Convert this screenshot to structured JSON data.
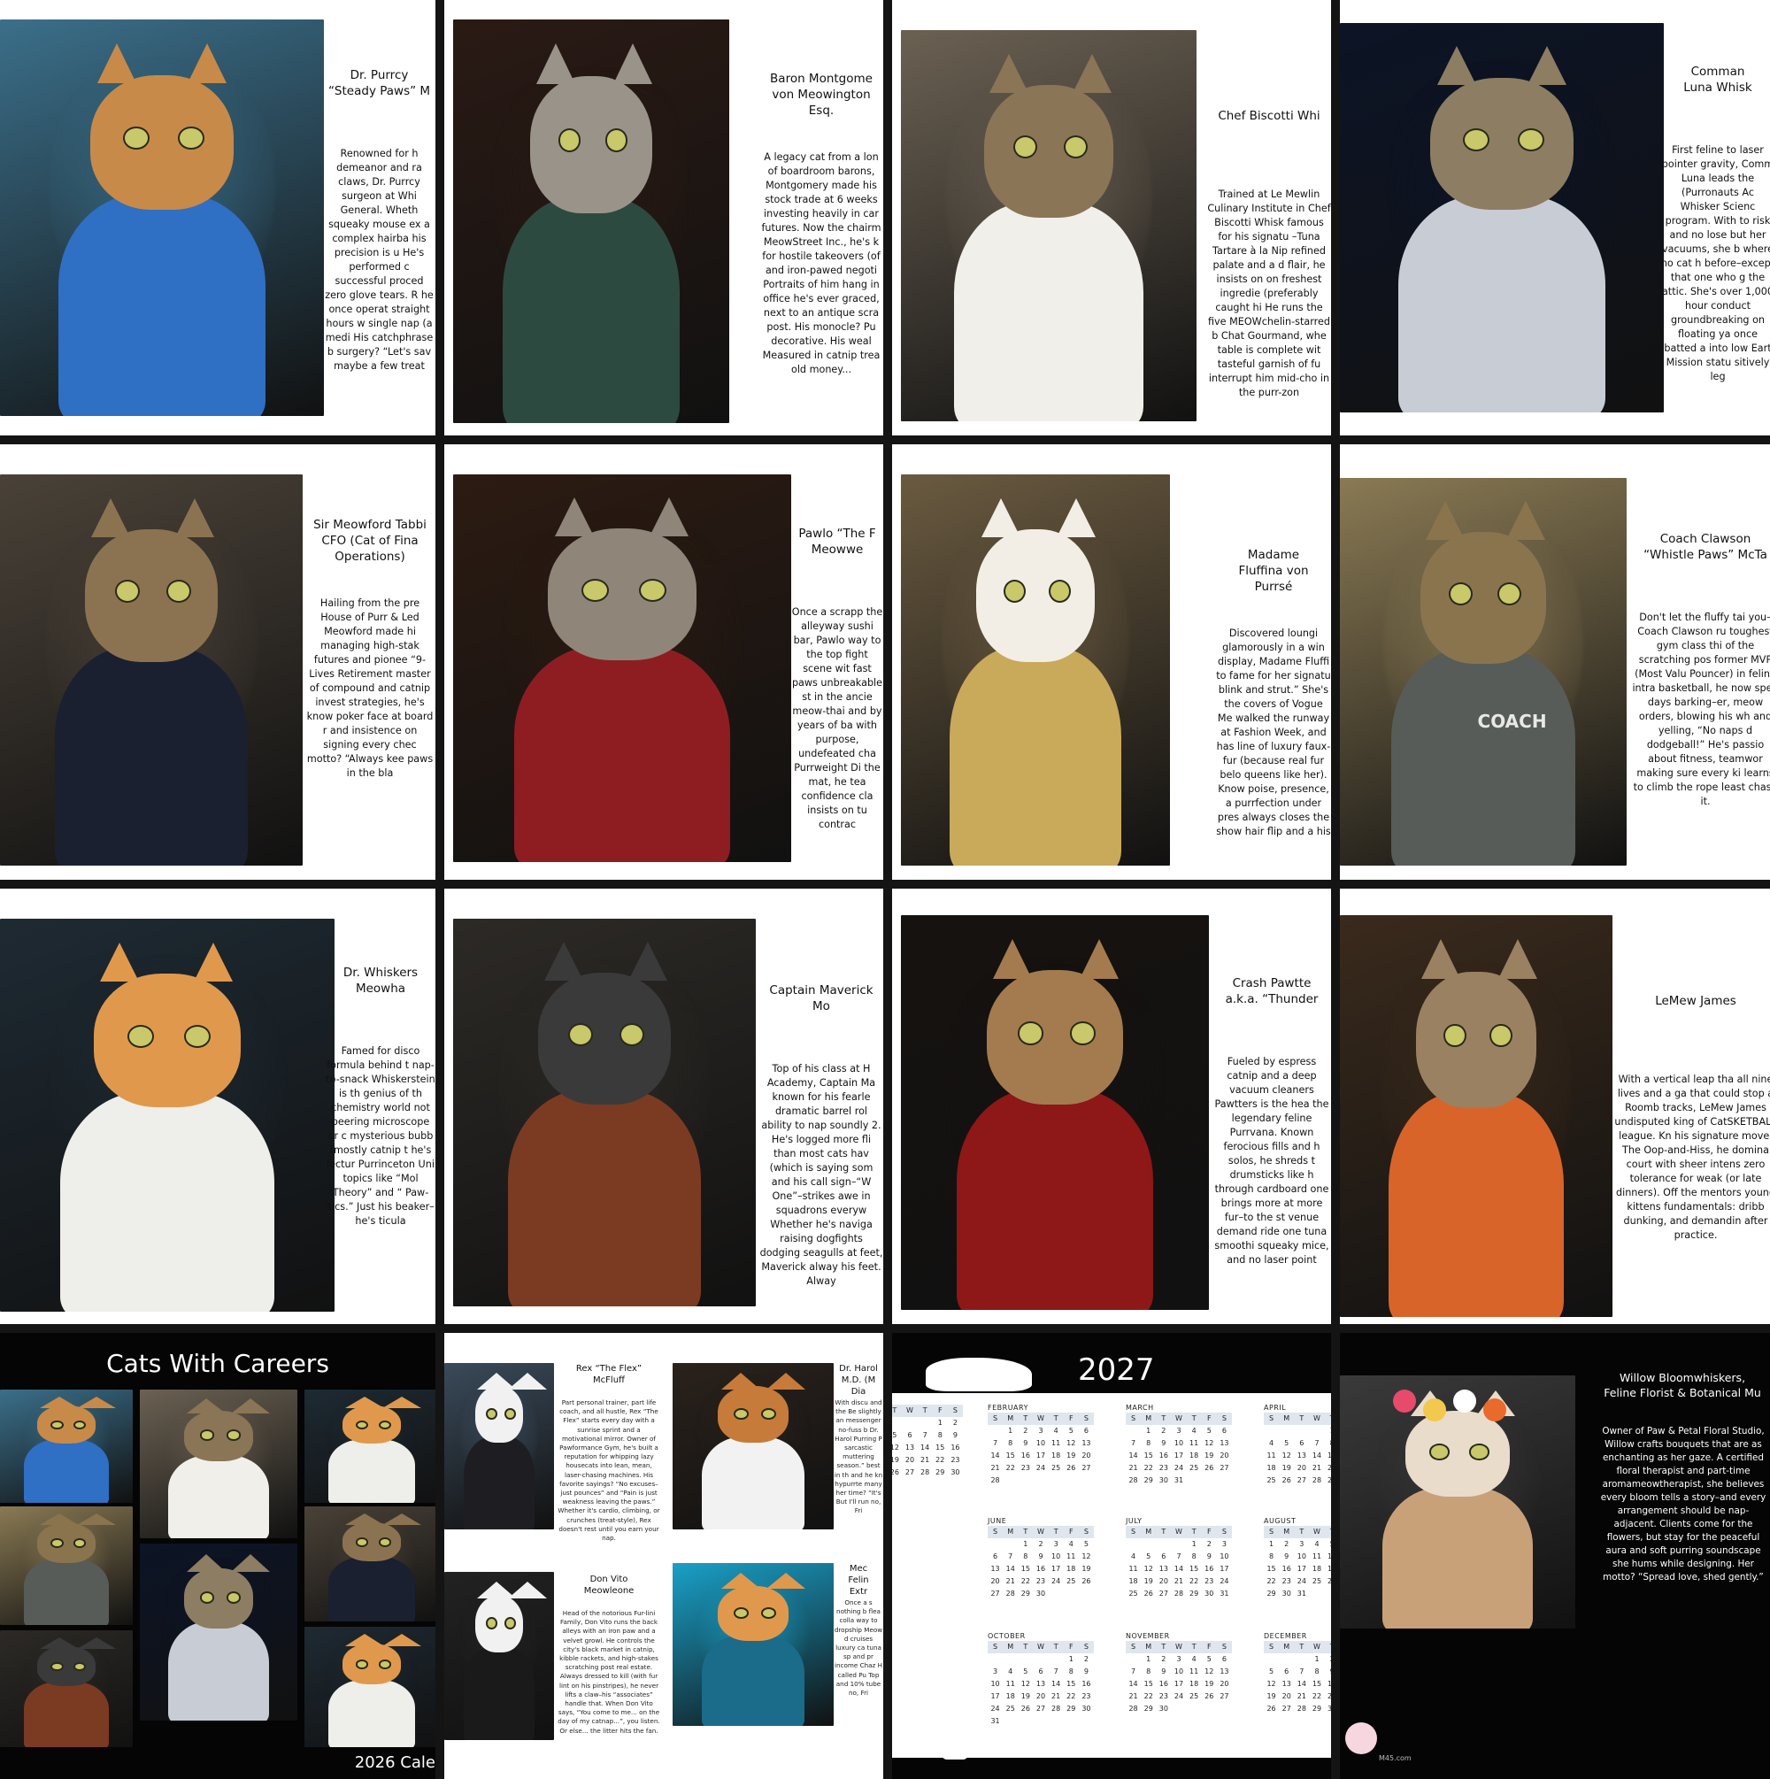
{
  "panels": [
    {
      "title": "Dr. Purrcy\n“Steady Paws” M",
      "body": "Renowned for h demeanor and ra claws, Dr. Purrcy surgeon at Whi General. Wheth squeaky mouse ex a complex hairba his precision is u He's performed c successful proced zero glove tears. R he once operat straight hours w single nap (a medi His catchphrase b surgery? “Let's sav maybe a few treat",
      "colors": {
        "bg": "#3b6f8a",
        "fur": "#c88a48",
        "body": "#2f6fc4"
      }
    },
    {
      "title": "Baron Montgome\nvon Meowington\nEsq.",
      "body": "A legacy cat from a lon of boardroom barons, Montgomery made his stock trade at 6 weeks investing heavily in car futures. Now the chairm MeowStreet Inc., he's k for hostile takeovers (of and iron-pawed negoti Portraits of him hang in office he's ever graced, next to an antique scra post. His monocle? Pu decorative. His weal Measured in catnip trea old money...",
      "colors": {
        "bg": "#2a1a14",
        "fur": "#9a938a",
        "body": "#2d4a40"
      }
    },
    {
      "title": "Chef Biscotti Whi",
      "body": "Trained at Le Mewlin Culinary Institute in Chef Biscotti Whisk famous for his signatu –Tuna Tartare à la Nip refined palate and a d flair, he insists on on freshest ingredie (preferably caught hi He runs the five MEOWchelin-starred b Chat Gourmand, whe table is complete wit tasteful garnish of fu interrupt him mid-cho in the purr-zon",
      "colors": {
        "bg": "#6b6153",
        "fur": "#8a7556",
        "body": "#f1efe9"
      }
    },
    {
      "title": "Comman\nLuna Whisk",
      "body": "First feline to laser pointer gravity, Comm Luna leads the (Purronauts Ac Whisker Scienc program. With to risk and no lose but her vacuums, she b where no cat h before–except that one who g the attic. She's over 1,000 hour conduct groundbreaking on floating ya once batted a into low Eart Mission statu sitively leg",
      "colors": {
        "bg": "#0c1426",
        "fur": "#8d7d62",
        "body": "#c8ccd4"
      }
    },
    {
      "title": "Sir Meowford Tabbi\nCFO (Cat of Fina\nOperations)",
      "body": "Hailing from the pre House of Purr & Led Meowford made hi managing high-stak futures and pionee “9-Lives Retirement master of compound and catnip invest strategies, he's know poker face at board r and insistence on signing every chec motto? “Always kee paws in the bla",
      "colors": {
        "bg": "#4a4238",
        "fur": "#8b7351",
        "body": "#1a2030"
      }
    },
    {
      "title": "Pawlo “The F\nMeowwe",
      "body": "Once a scrapp the alleyway sushi bar, Pawlo way to the top fight scene wit fast paws unbreakable st in the ancie meow-thai and by years of ba with purpose, undefeated cha Purrweight Di the mat, he tea confidence cla insists on tu contrac",
      "colors": {
        "bg": "#2c1b12",
        "fur": "#8f8679",
        "body": "#8e1d22"
      }
    },
    {
      "title": "Madame\nFluffina von\nPurrsé",
      "body": "Discovered loungi glamorously in a win display, Madame Fluffi to fame for her signatu blink and strut.” She's the covers of Vogue Me walked the runway at Fashion Week, and has line of luxury faux-fur (because real fur belo queens like her). Know poise, presence, a purrfection under pres always closes the show hair flip and a his",
      "colors": {
        "bg": "#6a5a40",
        "fur": "#f2eee6",
        "body": "#c9a95a"
      }
    },
    {
      "title": "Coach Clawson\n“Whistle Paws” McTa",
      "body": "Don't let the fluffy tai you–Coach Clawson ru toughest gym class thi of the scratching pos former MVP (Most Valu Pouncer) in feline intra basketball, he now spen days barking–er, meow orders, blowing his wh and yelling, “No naps d dodgeball!” He's passio about fitness, teamwor making sure every ki learns to climb the rope least chase it.",
      "badge": "COACH",
      "colors": {
        "bg": "#8a7a54",
        "fur": "#8a744e",
        "body": "#575c58"
      }
    },
    {
      "title": "Dr. Whiskers\nMeowha",
      "body": "Famed for disco formula behind t nap-to-snack Whiskerstein is th genius of th chemistry world not peering microscope or c mysterious bubb (mostly catnip t he's lectur Purrinceton Uni topics like “Mol Theory” and “ Paw-sics.” Just his beaker–he's ticula",
      "colors": {
        "bg": "#1e2a33",
        "fur": "#e0994c",
        "body": "#eeeeea"
      }
    },
    {
      "title": "Captain Maverick Mo",
      "body": "Top of his class at H Academy, Captain Ma known for his fearle dramatic barrel rol ability to nap soundly 2. He's logged more fli than most cats hav (which is saying som and his call sign–“W One”–strikes awe in squadrons everyw Whether he's naviga raising dogfights dodging seagulls at feet, Maverick alway his feet. Alway",
      "colors": {
        "bg": "#2d2a26",
        "fur": "#3a3a3a",
        "body": "#7b3b22"
      }
    },
    {
      "title": "Crash Pawtte\na.k.a. “Thunder",
      "body": "Fueled by espress catnip and a deep vacuum cleaners Pawtters is the hea the legendary feline Purrvana. Known ferocious fills and h solos, he shreds t drumsticks like h through cardboard one brings more at more fur–to the st venue demand ride one tuna smoothi squeaky mice, and no laser point",
      "colors": {
        "bg": "#161210",
        "fur": "#a37b4e",
        "body": "#8e1717"
      }
    },
    {
      "title": "LeMew James",
      "body": "With a vertical leap tha all nine lives and a ga that could stop a Roomb tracks, LeMew James undisputed king of CatSKETBALL league. Kn his signature move, The Oop-and-Hiss, he domina court with sheer intens zero tolerance for weak (or late dinners). Off the mentors young kittens fundamentals: dribb dunking, and demandin after practice.",
      "colors": {
        "bg": "#3a2a1c",
        "fur": "#9a8161",
        "body": "#d8642a"
      }
    }
  ],
  "cover": {
    "title": "Cats With Careers",
    "footer": "2026 Cale",
    "thumb_labels": [
      "COACH"
    ]
  },
  "spread": {
    "items": [
      {
        "title": "Rex “The Flex”\nMcFluff",
        "body": "Part personal trainer, part life coach, and all hustle, Rex “The Flex” starts every day with a sunrise sprint and a motivational mirror. Owner of Pawformance Gym, he's built a reputation for whipping lazy housecats into lean, mean, laser-chasing machines. His favorite sayings? “No excuses–just pounces” and “Pain is just weakness leaving the paws.” Whether it's cardio, climbing, or crunches (treat-style), Rex doesn't rest until you earn your nap."
      },
      {
        "title": "Dr. Harol\nM.D. (M\nDia",
        "body": "With discu and the Be slightly an messenger no-fuss b Dr. Harol Purring P sarcastic muttering season.” best in th and he kn hypurrte many her time? “It's But I'll run no, Fri"
      },
      {
        "title": "Don Vito\nMeowleone",
        "body": "Head of the notorious Fur-lini Family, Don Vito runs the back alleys with an iron paw and a velvet growl. He controls the city's black market in catnip, kibble rackets, and high-stakes scratching post real estate. Always dressed to kill (with fur lint on his pinstripes), he never lifts a claw–his “associates” handle that. When Don Vito says, “You come to me... on the day of my catnap...”, you listen. Or else... the litter hits the fan."
      },
      {
        "title": "Mec\nFelin\nExtr",
        "body": "Once a s nothing b flea colla way to dropship Meow d cruises luxury ca tuna sp and pr income Chaz H called Pu Top and 10% tube no, Fri"
      }
    ]
  },
  "calendar": {
    "year": "2027",
    "dow": [
      "S",
      "M",
      "T",
      "W",
      "T",
      "F",
      "S"
    ],
    "months": [
      {
        "name": "",
        "weeks": [
          [
            "",
            "",
            "",
            "",
            "T",
            "F",
            "S"
          ]
        ],
        "partial": true
      },
      {
        "name": "FEBRUARY"
      },
      {
        "name": "MARCH"
      },
      {
        "name": "APRIL"
      },
      {
        "name": "JUNE"
      },
      {
        "name": "JULY"
      },
      {
        "name": "AUGUST"
      },
      {
        "name": "OCTOBER"
      },
      {
        "name": "NOVEMBER"
      },
      {
        "name": "DECEMBER"
      }
    ]
  },
  "florist": {
    "title": "Willow Bloomwhiskers,\nFeline Florist & Botanical Mu",
    "body": "Owner of Paw & Petal Floral Studio, Willow crafts bouquets that are as enchanting as her gaze. A certified floral therapist and part-time aromameowtherapist, she believes every bloom tells a story–and every arrangement should be nap-adjacent. Clients come for the flowers, but stay for the peaceful aura and soft purring soundscape she hums while designing. Her motto? “Spread love, shed gently.”",
    "footer": "M45.com"
  }
}
